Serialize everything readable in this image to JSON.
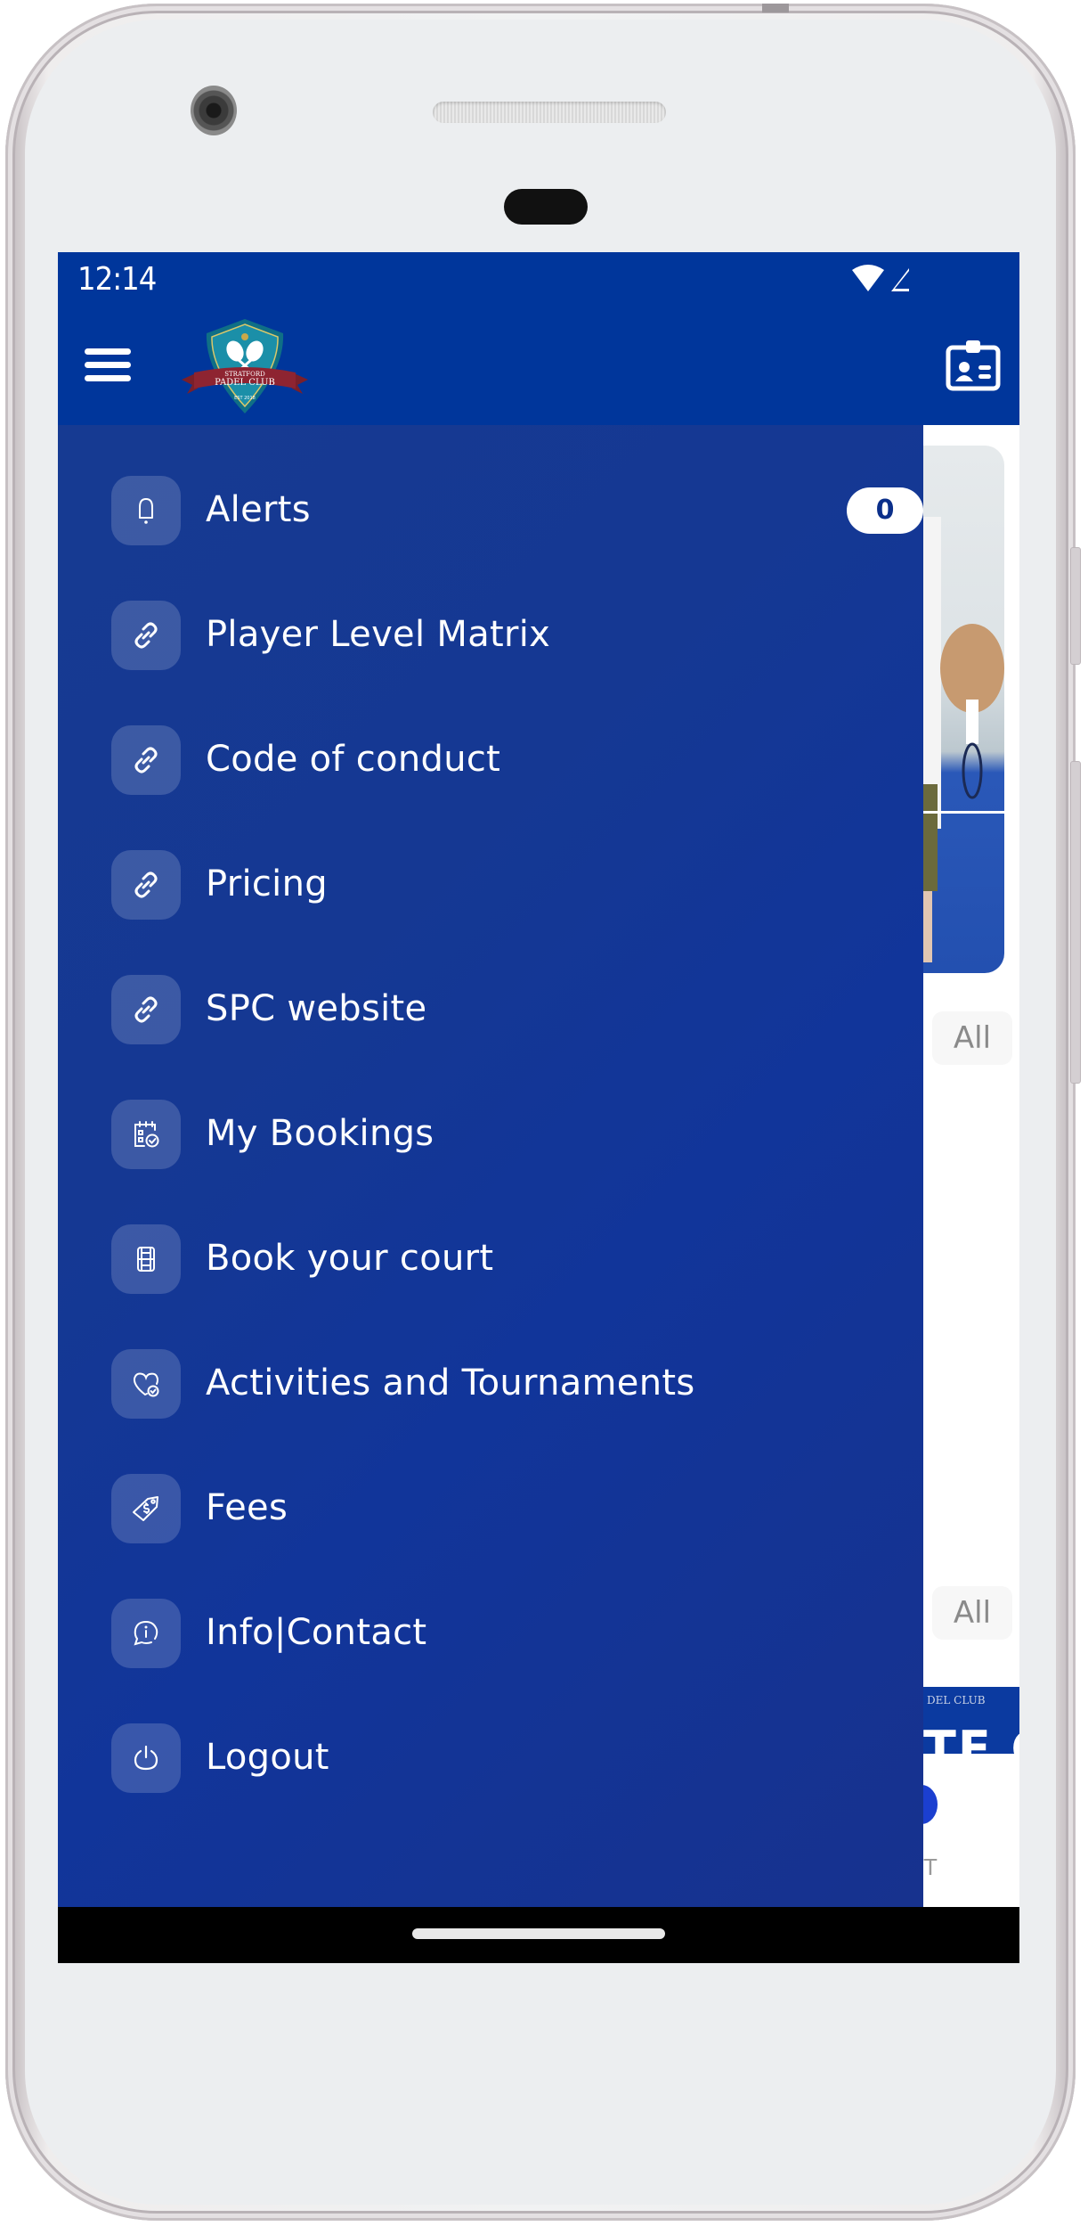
{
  "device": {
    "status_bar": {
      "time": "12:14",
      "icons": [
        "wifi-icon",
        "cellular-signal-icon"
      ]
    }
  },
  "app_bar": {
    "menu_icon": "hamburger-menu-icon",
    "logo": {
      "top_text": "STRATFORD",
      "main_text": "PADEL CLUB",
      "est_text": "EST 2018"
    },
    "right_icon": "member-card-icon"
  },
  "colors": {
    "brand_blue": "#00369b",
    "drawer_blue": "#153893",
    "badge_text": "#0b2f8a",
    "logo_teal": "#1b8fa8",
    "logo_ribbon": "#8e2431"
  },
  "drawer": {
    "items": [
      {
        "label": "Alerts",
        "icon": "bell-icon",
        "badge": "0"
      },
      {
        "label": "Player Level Matrix",
        "icon": "link-icon"
      },
      {
        "label": "Code of conduct",
        "icon": "link-icon"
      },
      {
        "label": "Pricing",
        "icon": "link-icon"
      },
      {
        "label": "SPC website",
        "icon": "link-icon"
      },
      {
        "label": "My Bookings",
        "icon": "calendar-check-icon"
      },
      {
        "label": "Book your court",
        "icon": "court-icon"
      },
      {
        "label": "Activities and Tournaments",
        "icon": "heart-check-icon"
      },
      {
        "label": "Fees",
        "icon": "price-tag-icon"
      },
      {
        "label": "Info|Contact",
        "icon": "info-chat-icon"
      },
      {
        "label": "Logout",
        "icon": "power-icon"
      }
    ]
  },
  "background_page": {
    "see_all_label_1": "All",
    "see_all_label_2": "All",
    "promo_text": "TE C",
    "promo_logo_text": "DEL CLUB",
    "trailing_text": "T"
  }
}
